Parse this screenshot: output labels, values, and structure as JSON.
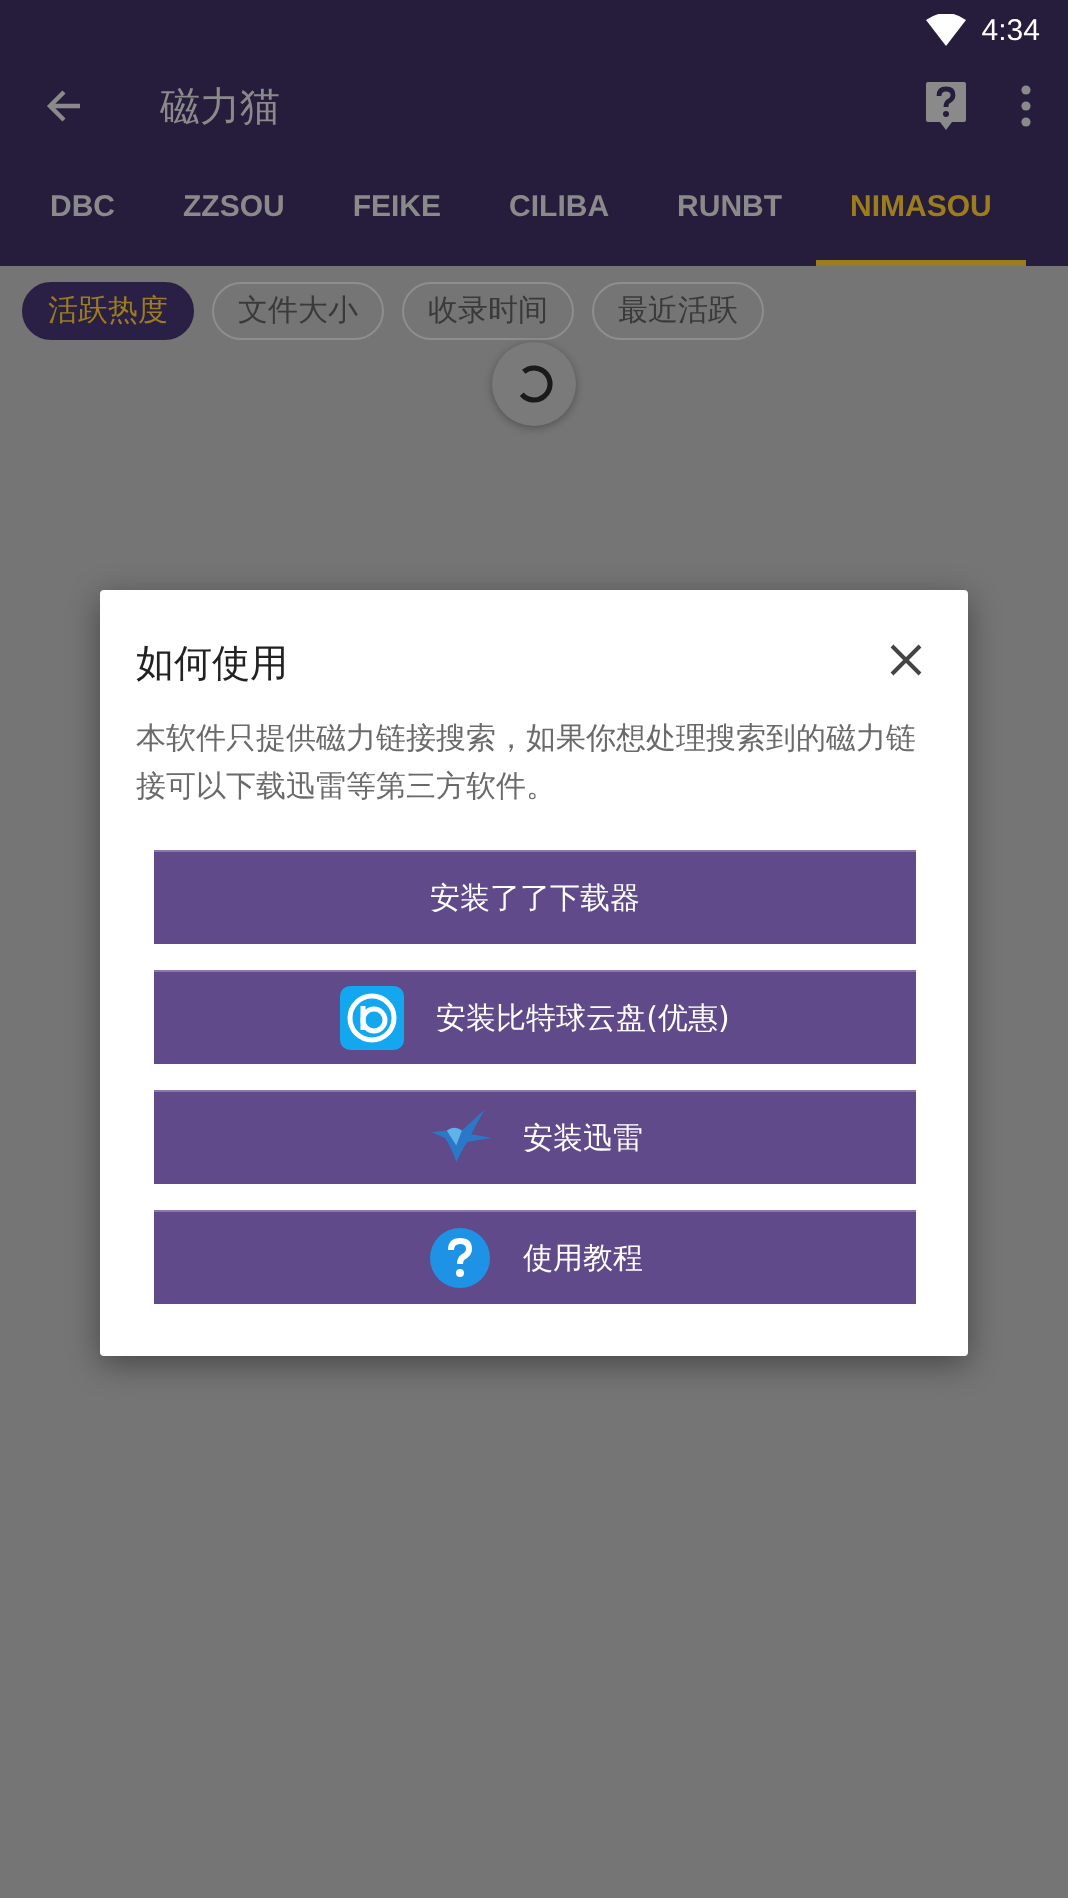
{
  "status_bar": {
    "time": "4:34"
  },
  "app_bar": {
    "title": "磁力猫"
  },
  "tabs": [
    {
      "label": "DBC",
      "selected": false
    },
    {
      "label": "ZZSOU",
      "selected": false
    },
    {
      "label": "FEIKE",
      "selected": false
    },
    {
      "label": "CILIBA",
      "selected": false
    },
    {
      "label": "RUNBT",
      "selected": false
    },
    {
      "label": "NIMASOU",
      "selected": true
    }
  ],
  "sort_chips": [
    {
      "label": "活跃热度",
      "selected": true
    },
    {
      "label": "文件大小",
      "selected": false
    },
    {
      "label": "收录时间",
      "selected": false
    },
    {
      "label": "最近活跃",
      "selected": false
    }
  ],
  "dialog": {
    "title": "如何使用",
    "message": "本软件只提供磁力链接搜索，如果你想处理搜索到的磁力链接可以下载迅雷等第三方软件。",
    "buttons": [
      {
        "label": "安装了了下载器",
        "kind": "plain"
      },
      {
        "label": "安装比特球云盘(优惠)",
        "kind": "cloud"
      },
      {
        "label": "安装迅雷",
        "kind": "bird"
      },
      {
        "label": "使用教程",
        "kind": "help"
      }
    ]
  }
}
